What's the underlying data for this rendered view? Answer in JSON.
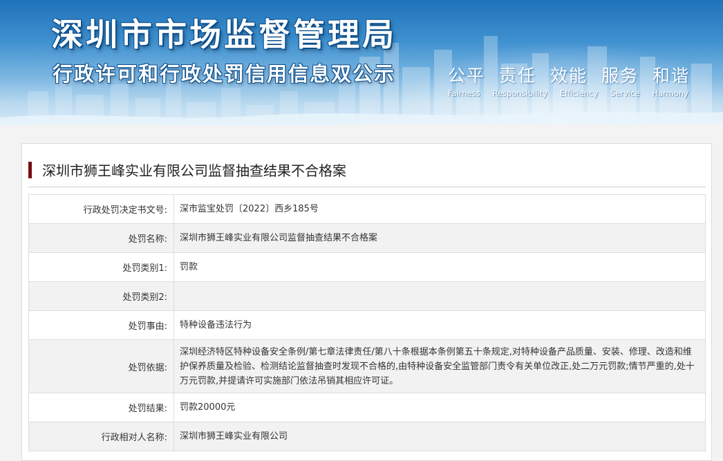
{
  "header": {
    "title": "深圳市市场监督管理局",
    "subtitle": "行政许可和行政处罚信用信息双公示",
    "mottos_cn": [
      "公平",
      "责任",
      "效能",
      "服务",
      "和谐"
    ],
    "mottos_en": [
      "Fairness",
      "Responsibility",
      "Efficiency",
      "Service",
      "Harmony"
    ]
  },
  "case": {
    "title": "深圳市狮王峰实业有限公司监督抽查结果不合格案",
    "fields": [
      {
        "label": "行政处罚决定书文号:",
        "value": "深市监宝处罚〔2022〕西乡185号"
      },
      {
        "label": "处罚名称:",
        "value": "深圳市狮王峰实业有限公司监督抽查结果不合格案"
      },
      {
        "label": "处罚类别1:",
        "value": "罚款"
      },
      {
        "label": "处罚类别2:",
        "value": ""
      },
      {
        "label": "处罚事由:",
        "value": "特种设备违法行为"
      },
      {
        "label": "处罚依据:",
        "value": "深圳经济特区特种设备安全条例/第七章法律责任/第八十条根据本条例第五十条规定,对特种设备产品质量、安装、修理、改造和维护保养质量及检验、检测结论监督抽查时发现不合格的,由特种设备安全监管部门责令有关单位改正,处二万元罚款;情节严重的,处十万元罚款,并提请许可实施部门依法吊销其相应许可证。"
      },
      {
        "label": "处罚结果:",
        "value": "罚款20000元"
      },
      {
        "label": "行政相对人名称:",
        "value": "深圳市狮王峰实业有限公司"
      }
    ]
  },
  "colors": {
    "accent_bar": "#7a0c12",
    "banner_top": "#1f73b9",
    "banner_bottom": "#dfeefa",
    "row_alt": "#f2f2f2"
  }
}
